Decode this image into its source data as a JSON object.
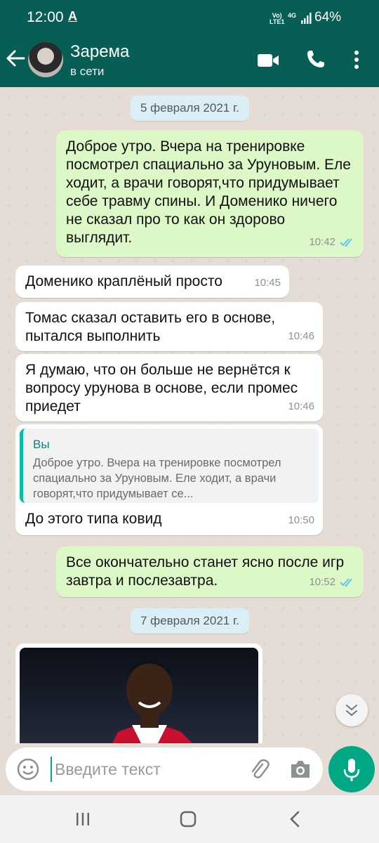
{
  "status_bar": {
    "time": "12:00",
    "indicator_a": "A",
    "net_volte": "Vo)",
    "net_lte": "LTE1",
    "net_4g": "4G",
    "battery": "64%"
  },
  "header": {
    "contact_name": "Зарема",
    "contact_status": "в сети",
    "icons": [
      "back-arrow-icon",
      "video-call-icon",
      "voice-call-icon",
      "more-options-icon"
    ]
  },
  "chat": {
    "date1": "5 февраля 2021 г.",
    "messages": [
      {
        "direction": "out",
        "text": "Доброе утро. Вчера на тренировке посмотрел спациально за Уруновым. Еле ходит, а врачи говорят,что придумывает себе травму спины. И Доменико ничего не сказал про то как он здорово выглядит.",
        "time": "10:42"
      },
      {
        "direction": "in",
        "text": "Доменико краплёный просто",
        "time": "10:45"
      },
      {
        "direction": "in",
        "text": "Томас сказал оставить его в основе, пытался выполнить",
        "time": "10:46"
      },
      {
        "direction": "in",
        "text": "Я думаю, что он больше не вернётся к вопросу урунова в основе, если промес приедет",
        "time": "10:46"
      },
      {
        "direction": "in",
        "quote_author": "Вы",
        "quote_text": "Доброе утро. Вчера на тренировке посмотрел спациально за Уруновым. Еле ходит, а врачи говорят,что придумывает се...",
        "text": "До этого типа ковид",
        "time": "10:50"
      },
      {
        "direction": "out",
        "text": "Все окончательно станет ясно после игр завтра и послезавтра.",
        "time": "10:52"
      }
    ],
    "date2": "7 февраля 2021 г."
  },
  "input": {
    "placeholder": "Введите текст"
  },
  "colors": {
    "header_bg": "#075e54",
    "outgoing_bubble": "#dcf8c6",
    "incoming_bubble": "#ffffff",
    "accent": "#00a884",
    "read_ticks": "#4fc3f7"
  }
}
